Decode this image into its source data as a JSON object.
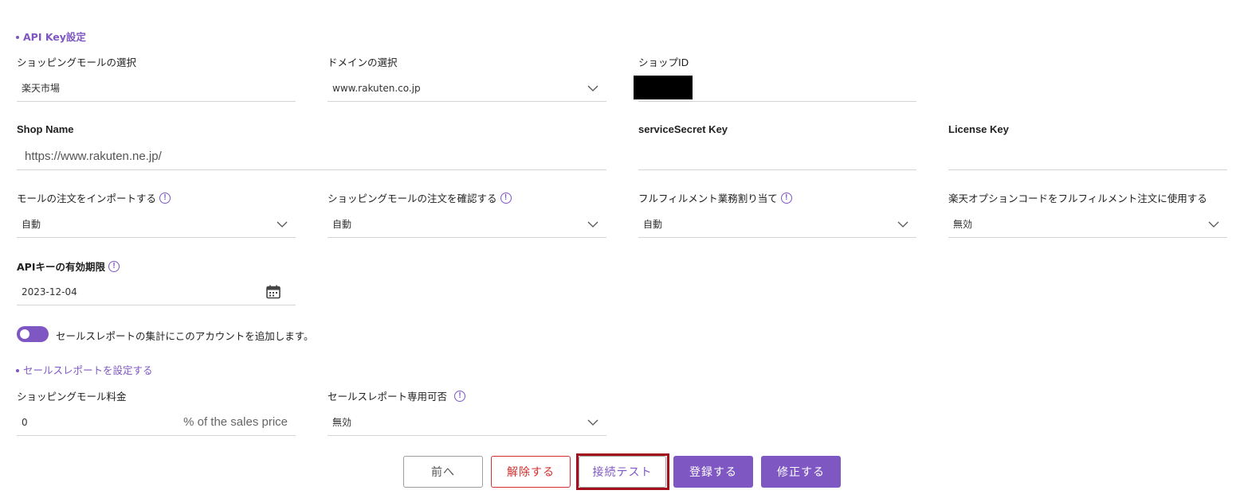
{
  "sections": {
    "api_key": "API Key設定",
    "sales_report": "セールスレポートを設定する"
  },
  "fields": {
    "mall_select": {
      "label": "ショッピングモールの選択",
      "value": "楽天市場"
    },
    "domain_select": {
      "label": "ドメインの選択",
      "value": "www.rakuten.co.jp"
    },
    "shop_id": {
      "label": "ショップID",
      "value": ""
    },
    "shop_name": {
      "label": "Shop Name",
      "placeholder": "https://www.rakuten.ne.jp/"
    },
    "service_secret": {
      "label": "serviceSecret Key",
      "value": ""
    },
    "license_key": {
      "label": "License Key",
      "value": ""
    },
    "import_orders": {
      "label": "モールの注文をインポートする",
      "value": "自動"
    },
    "confirm_orders": {
      "label": "ショッピングモールの注文を確認する",
      "value": "自動"
    },
    "fulfillment_assign": {
      "label": "フルフィルメント業務割り当て",
      "value": "自動"
    },
    "option_code": {
      "label": "楽天オプションコードをフルフィルメント注文に使用する",
      "value": "無効"
    },
    "api_expiry": {
      "label": "APIキーの有効期限",
      "value": "2023-12-04"
    },
    "mall_fee": {
      "label": "ショッピングモール料金",
      "value": "0",
      "suffix": "% of the sales price"
    },
    "sales_report_only": {
      "label": "セールスレポート専用可否",
      "value": "無効"
    }
  },
  "toggle": {
    "label": "セールスレポートの集計にこのアカウントを追加します。",
    "on": true
  },
  "buttons": {
    "prev": "前へ",
    "release": "解除する",
    "test": "接続テスト",
    "register": "登録する",
    "modify": "修正する"
  },
  "icons": {
    "info": "!"
  },
  "colors": {
    "accent": "#7e57c2",
    "danger": "#d32f2f",
    "highlight": "#a30f1c"
  }
}
